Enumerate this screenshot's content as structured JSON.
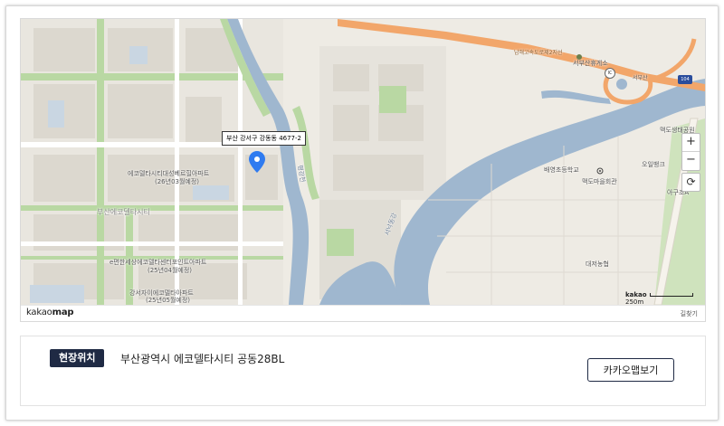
{
  "map": {
    "marker_label": "부산 강서구 강동동 4677-2",
    "place_labels": [
      {
        "id": "apt1-name",
        "text": "에코델타시티대성베르힐아파트"
      },
      {
        "id": "apt1-date",
        "text": "(26년03월예정)"
      },
      {
        "id": "district",
        "text": "부산에코델타시티"
      },
      {
        "id": "apt2-name",
        "text": "e편한세상에코델타센터포인트아파트"
      },
      {
        "id": "apt2-date",
        "text": "(25년04월예정)"
      },
      {
        "id": "apt3-name",
        "text": "강서자이에코델타아파트"
      },
      {
        "id": "apt3-date",
        "text": "(25년05월예정)"
      },
      {
        "id": "highway",
        "text": "남해고속도로제2지선"
      },
      {
        "id": "rest-area",
        "text": "서부산휴게소"
      },
      {
        "id": "ic",
        "text": "서부산"
      },
      {
        "id": "station",
        "text": "맥도생태공원"
      },
      {
        "id": "school",
        "text": "배영초등학교"
      },
      {
        "id": "oil-bank",
        "text": "오일뱅크"
      },
      {
        "id": "village-hall",
        "text": "맥도마을회관"
      },
      {
        "id": "rice-agency",
        "text": "대저농협"
      },
      {
        "id": "gate",
        "text": "아구조A"
      },
      {
        "id": "river-1",
        "text": "평강천"
      },
      {
        "id": "river-2",
        "text": "서낙동강"
      }
    ],
    "ic_badge": "IC",
    "route_shield": "104",
    "zoom_in": "+",
    "zoom_out": "−",
    "refresh": "⟳",
    "scale_label": "250m",
    "scale_logo": "kakao",
    "footer_logo_light": "kakao",
    "footer_logo_bold": "map",
    "footer_route": "길찾기",
    "pin_icon": "map-pin-icon",
    "colors": {
      "land": "#eeebe4",
      "water": "#9fb7cf",
      "park": "#b9d8a3",
      "highway": "#f2a66a",
      "pin": "#2f7bf0"
    }
  },
  "location": {
    "badge": "현장위치",
    "address": "부산광역시 에코델타시티 공동28BL",
    "button": "카카오맵보기"
  }
}
